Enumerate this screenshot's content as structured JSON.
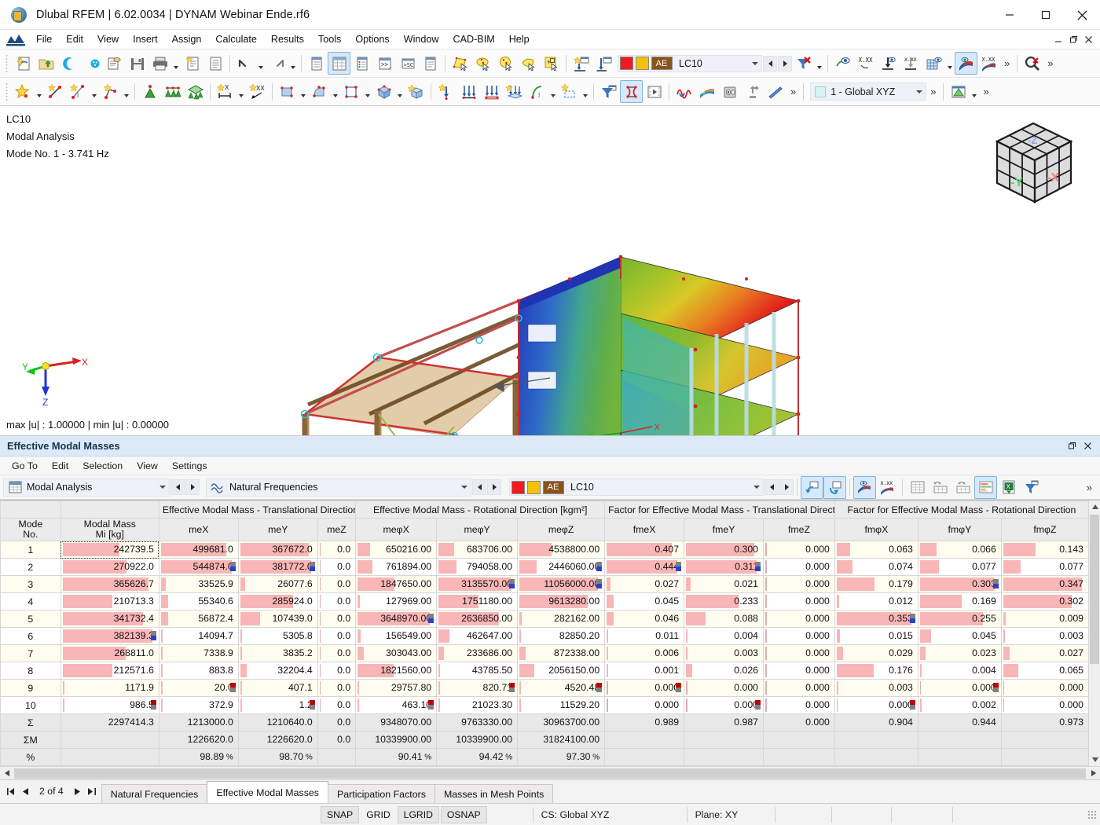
{
  "window": {
    "title": "Dlubal RFEM | 6.02.0034 | DYNAM Webinar Ende.rf6",
    "minimize": "─",
    "maximize": "□",
    "close": "✕"
  },
  "menubar": {
    "items": [
      "File",
      "Edit",
      "View",
      "Insert",
      "Assign",
      "Calculate",
      "Results",
      "Tools",
      "Options",
      "Window",
      "CAD-BIM",
      "Help"
    ]
  },
  "toolbar1": {
    "load_case_label": "LC10",
    "ae_label": "AE",
    "colors": {
      "red": "#ee1b22",
      "yellow": "#f5c109",
      "brown": "#8a5418"
    },
    "overflow": "»"
  },
  "toolbar2": {
    "cs_label": "1 - Global XYZ",
    "overflow": "»"
  },
  "viewport": {
    "line1": "LC10",
    "line2": "Modal Analysis",
    "line3": "Mode No. 1 - 3.741 Hz",
    "minmax": "max |u| : 1.00000 | min |u| : 0.00000",
    "axis": {
      "x": "X",
      "y": "Y",
      "z": "Z"
    },
    "navcube": {
      "left_face": "-Y",
      "right_face": "-X",
      "top_face": "-Z"
    }
  },
  "panel": {
    "title": "Effective Modal Masses",
    "menu": [
      "Go To",
      "Edit",
      "Selection",
      "View",
      "Settings"
    ],
    "combo_analysis": "Modal Analysis",
    "combo_result": "Natural Frequencies",
    "combo_loadcase": "LC10",
    "ae_label": "AE"
  },
  "table": {
    "group_headers": [
      {
        "label": "",
        "span": 1
      },
      {
        "label": "",
        "span": 1
      },
      {
        "label": "Effective Modal Mass - Translational Direction [kg]",
        "span": 3
      },
      {
        "label": "Effective Modal Mass - Rotational Direction [kgm²]",
        "span": 3
      },
      {
        "label": "Factor for Effective Modal Mass - Translational Direction",
        "span": 3
      },
      {
        "label": "Factor for Effective Modal Mass - Rotational Direction",
        "span": 3
      }
    ],
    "col_headers": [
      {
        "l1": "Mode",
        "l2": "No."
      },
      {
        "l1": "Modal Mass",
        "l2": "Mi [kg]"
      },
      {
        "l1": "",
        "l2": "meX"
      },
      {
        "l1": "",
        "l2": "meY"
      },
      {
        "l1": "",
        "l2": "meZ"
      },
      {
        "l1": "",
        "l2": "meφX"
      },
      {
        "l1": "",
        "l2": "meφY"
      },
      {
        "l1": "",
        "l2": "meφZ"
      },
      {
        "l1": "",
        "l2": "fmeX"
      },
      {
        "l1": "",
        "l2": "fmeY"
      },
      {
        "l1": "",
        "l2": "fmeZ"
      },
      {
        "l1": "",
        "l2": "fmφX"
      },
      {
        "l1": "",
        "l2": "fmφY"
      },
      {
        "l1": "",
        "l2": "fmφZ"
      }
    ],
    "rows": [
      {
        "mode": "1",
        "mi": "242739.5",
        "meX": "499681.0",
        "meY": "367672.0",
        "meZ": "0.0",
        "mephX": "650216.00",
        "mephY": "683706.00",
        "mephZ": "4538800.00",
        "fmeX": "0.407",
        "fmeY": "0.300",
        "fmeZ": "0.000",
        "fmphX": "0.063",
        "fmphY": "0.066",
        "fmphZ": "0.143"
      },
      {
        "mode": "2",
        "mi": "270922.0",
        "meX": "544874.0",
        "meY": "381772.0",
        "meZ": "0.0",
        "mephX": "761894.00",
        "mephY": "794058.00",
        "mephZ": "2446060.00",
        "fmeX": "0.444",
        "fmeY": "0.311",
        "fmeZ": "0.000",
        "fmphX": "0.074",
        "fmphY": "0.077",
        "fmphZ": "0.077"
      },
      {
        "mode": "3",
        "mi": "365626.7",
        "meX": "33525.9",
        "meY": "26077.6",
        "meZ": "0.0",
        "mephX": "1847650.00",
        "mephY": "3135570.00",
        "mephZ": "11056000.00",
        "fmeX": "0.027",
        "fmeY": "0.021",
        "fmeZ": "0.000",
        "fmphX": "0.179",
        "fmphY": "0.303",
        "fmphZ": "0.347"
      },
      {
        "mode": "4",
        "mi": "210713.3",
        "meX": "55340.6",
        "meY": "285924.0",
        "meZ": "0.0",
        "mephX": "127969.00",
        "mephY": "1751180.00",
        "mephZ": "9613280.00",
        "fmeX": "0.045",
        "fmeY": "0.233",
        "fmeZ": "0.000",
        "fmphX": "0.012",
        "fmphY": "0.169",
        "fmphZ": "0.302"
      },
      {
        "mode": "5",
        "mi": "341732.4",
        "meX": "56872.4",
        "meY": "107439.0",
        "meZ": "0.0",
        "mephX": "3648970.00",
        "mephY": "2636850.00",
        "mephZ": "282162.00",
        "fmeX": "0.046",
        "fmeY": "0.088",
        "fmeZ": "0.000",
        "fmphX": "0.353",
        "fmphY": "0.255",
        "fmphZ": "0.009"
      },
      {
        "mode": "6",
        "mi": "382139.3",
        "meX": "14094.7",
        "meY": "5305.8",
        "meZ": "0.0",
        "mephX": "156549.00",
        "mephY": "462647.00",
        "mephZ": "82850.20",
        "fmeX": "0.011",
        "fmeY": "0.004",
        "fmeZ": "0.000",
        "fmphX": "0.015",
        "fmphY": "0.045",
        "fmphZ": "0.003"
      },
      {
        "mode": "7",
        "mi": "268811.0",
        "meX": "7338.9",
        "meY": "3835.2",
        "meZ": "0.0",
        "mephX": "303043.00",
        "mephY": "233686.00",
        "mephZ": "872338.00",
        "fmeX": "0.006",
        "fmeY": "0.003",
        "fmeZ": "0.000",
        "fmphX": "0.029",
        "fmphY": "0.023",
        "fmphZ": "0.027"
      },
      {
        "mode": "8",
        "mi": "212571.6",
        "meX": "883.8",
        "meY": "32204.4",
        "meZ": "0.0",
        "mephX": "1821560.00",
        "mephY": "43785.50",
        "mephZ": "2056150.00",
        "fmeX": "0.001",
        "fmeY": "0.026",
        "fmeZ": "0.000",
        "fmphX": "0.176",
        "fmphY": "0.004",
        "fmphZ": "0.065"
      },
      {
        "mode": "9",
        "mi": "1171.9",
        "meX": "20.0",
        "meY": "407.1",
        "meZ": "0.0",
        "mephX": "29757.80",
        "mephY": "820.71",
        "mephZ": "4520.48",
        "fmeX": "0.000",
        "fmeY": "0.000",
        "fmeZ": "0.000",
        "fmphX": "0.003",
        "fmphY": "0.000",
        "fmphZ": "0.000"
      },
      {
        "mode": "10",
        "mi": "986.5",
        "meX": "372.9",
        "meY": "1.2",
        "meZ": "0.0",
        "mephX": "463.10",
        "mephY": "21023.30",
        "mephZ": "11529.20",
        "fmeX": "0.000",
        "fmeY": "0.000",
        "fmeZ": "0.000",
        "fmphX": "0.000",
        "fmphY": "0.002",
        "fmphZ": "0.000"
      }
    ],
    "sum_row": {
      "mode": "Σ",
      "mi": "2297414.3",
      "meX": "1213000.0",
      "meY": "1210640.0",
      "meZ": "0.0",
      "mephX": "9348070.00",
      "mephY": "9763330.00",
      "mephZ": "30963700.00",
      "fmeX": "0.989",
      "fmeY": "0.987",
      "fmeZ": "0.000",
      "fmphX": "0.904",
      "fmphY": "0.944",
      "fmphZ": "0.973"
    },
    "summ_row": {
      "mode": "ΣM",
      "mi": "",
      "meX": "1226620.0",
      "meY": "1226620.0",
      "meZ": "0.0",
      "mephX": "10339900.00",
      "mephY": "10339900.00",
      "mephZ": "31824100.00",
      "fmeX": "",
      "fmeY": "",
      "fmeZ": "",
      "fmphX": "",
      "fmphY": "",
      "fmphZ": ""
    },
    "pct_row": {
      "mode": "%",
      "mi": "",
      "meX": "98.89",
      "meY": "98.70",
      "meZ": "",
      "mephX": "90.41",
      "mephY": "94.42",
      "mephZ": "97.30",
      "fmeX": "",
      "fmeY": "",
      "fmeZ": "",
      "fmphX": "",
      "fmphY": "",
      "fmphZ": ""
    },
    "pct_symbol": "%",
    "bar_color": "#f8b6b6"
  },
  "tabs": {
    "pager_text": "2 of 4",
    "items": [
      "Natural Frequencies",
      "Effective Modal Masses",
      "Participation Factors",
      "Masses in Mesh Points"
    ],
    "active_index": 1
  },
  "statusbar": {
    "snaps": [
      "SNAP",
      "GRID",
      "LGRID",
      "OSNAP"
    ],
    "snaps_on": [
      "SNAP",
      "LGRID",
      "OSNAP"
    ],
    "cs": "CS: Global XYZ",
    "plane": "Plane: XY"
  }
}
